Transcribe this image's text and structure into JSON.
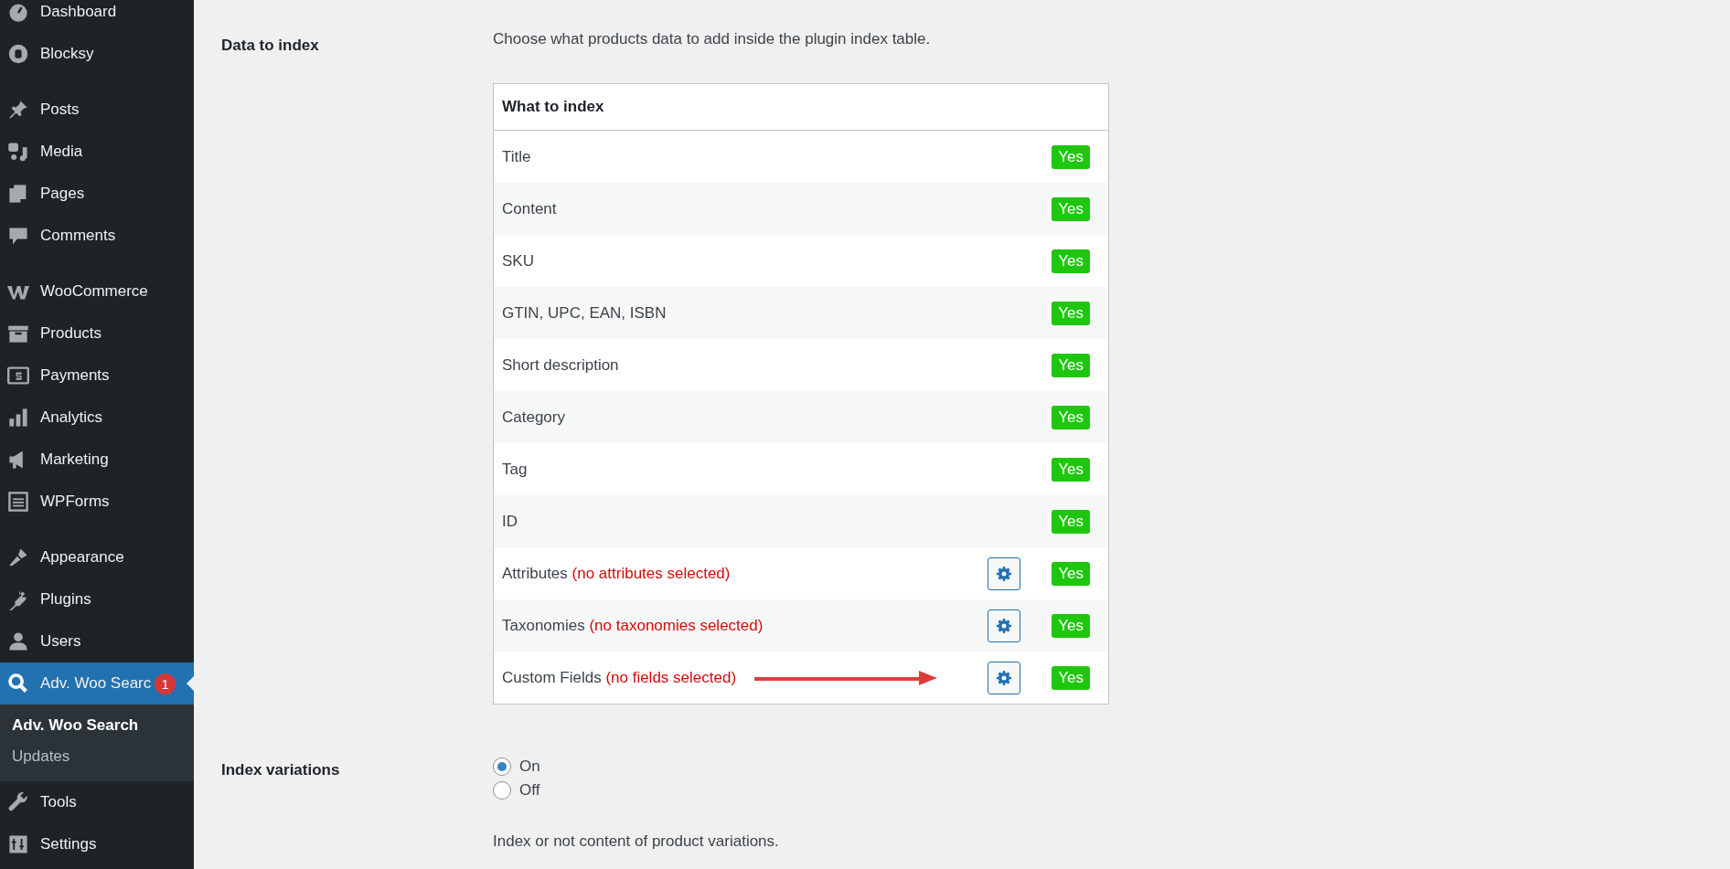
{
  "sidebar": {
    "groups": [
      {
        "items": [
          {
            "label": "Dashboard",
            "active": false
          },
          {
            "label": "Blocksy",
            "active": false
          }
        ]
      },
      {
        "items": [
          {
            "label": "Posts",
            "active": false
          },
          {
            "label": "Media",
            "active": false
          },
          {
            "label": "Pages",
            "active": false
          },
          {
            "label": "Comments",
            "active": false
          }
        ]
      },
      {
        "items": [
          {
            "label": "WooCommerce",
            "active": false
          },
          {
            "label": "Products",
            "active": false
          },
          {
            "label": "Payments",
            "active": false
          },
          {
            "label": "Analytics",
            "active": false
          },
          {
            "label": "Marketing",
            "active": false
          },
          {
            "label": "WPForms",
            "active": false
          }
        ]
      },
      {
        "items": [
          {
            "label": "Appearance",
            "active": false
          },
          {
            "label": "Plugins",
            "active": false
          },
          {
            "label": "Users",
            "active": false
          },
          {
            "label": "Adv. Woo Searc",
            "active": true,
            "badge": "1",
            "submenu": [
              {
                "label": "Adv. Woo Search",
                "selected": true
              },
              {
                "label": "Updates",
                "selected": false
              }
            ]
          },
          {
            "label": "Tools",
            "active": false
          },
          {
            "label": "Settings",
            "active": false
          }
        ]
      }
    ]
  },
  "settings": [
    {
      "kind": "table",
      "label": "Data to index",
      "description": "Choose what products data to add inside the plugin index table.",
      "table": {
        "header": "What to index",
        "rows": [
          {
            "kind": "plain",
            "label": "Title",
            "value": "Yes",
            "arrow": false
          },
          {
            "kind": "plain",
            "label": "Content",
            "value": "Yes",
            "arrow": false
          },
          {
            "kind": "plain",
            "label": "SKU",
            "value": "Yes",
            "arrow": false
          },
          {
            "kind": "plain",
            "label": "GTIN, UPC, EAN, ISBN",
            "value": "Yes",
            "arrow": false
          },
          {
            "kind": "plain",
            "label": "Short description",
            "value": "Yes",
            "arrow": false
          },
          {
            "kind": "plain",
            "label": "Category",
            "value": "Yes",
            "arrow": false
          },
          {
            "kind": "plain",
            "label": "Tag",
            "value": "Yes",
            "arrow": false
          },
          {
            "kind": "plain",
            "label": "ID",
            "value": "Yes",
            "arrow": false
          },
          {
            "kind": "configurable",
            "label": "Attributes",
            "note": "(no attributes selected)",
            "value": "Yes",
            "arrow": false
          },
          {
            "kind": "configurable",
            "label": "Taxonomies",
            "note": "(no taxonomies selected)",
            "value": "Yes",
            "arrow": false
          },
          {
            "kind": "configurable",
            "label": "Custom Fields",
            "note": "(no fields selected)",
            "value": "Yes",
            "arrow": true
          }
        ]
      }
    },
    {
      "kind": "radio",
      "label": "Index variations",
      "options": [
        {
          "label": "On",
          "selected": true
        },
        {
          "label": "Off",
          "selected": false
        }
      ],
      "description": "Index or not content of product variations."
    }
  ]
}
